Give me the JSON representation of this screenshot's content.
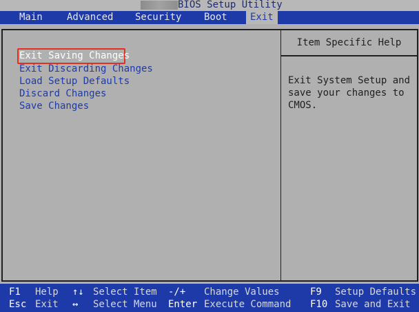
{
  "window": {
    "title": "BIOS Setup Utility"
  },
  "menu": {
    "tabs": [
      {
        "label": "Main"
      },
      {
        "label": "Advanced"
      },
      {
        "label": "Security"
      },
      {
        "label": "Boot"
      },
      {
        "label": "Exit",
        "active": true
      }
    ]
  },
  "exit_options": [
    {
      "label": "Exit Saving Changes",
      "selected": true
    },
    {
      "label": "Exit Discarding Changes"
    },
    {
      "label": "Load Setup Defaults"
    },
    {
      "label": "Discard Changes"
    },
    {
      "label": "Save Changes"
    }
  ],
  "help": {
    "title": "Item Specific Help",
    "text": "Exit System Setup and\nsave your changes to\nCMOS."
  },
  "footer": {
    "row1": [
      {
        "key": "F1",
        "action": "Help"
      },
      {
        "key": "↑↓",
        "action": "Select Item"
      },
      {
        "key": "-/+",
        "action": "Change Values"
      },
      {
        "key": "F9",
        "action": "Setup Defaults"
      }
    ],
    "row2": [
      {
        "key": "Esc",
        "action": "Exit"
      },
      {
        "key": "↔",
        "action": "Select Menu"
      },
      {
        "key": "Enter",
        "action": "Execute Command"
      },
      {
        "key": "F10",
        "action": "Save and Exit"
      }
    ]
  },
  "colors": {
    "menu_bar": "#1e3aa8",
    "background": "#b0b0b0",
    "option_text": "#1e3aa8",
    "selected_text": "#ffffff",
    "selection_outline": "#e0301e"
  }
}
